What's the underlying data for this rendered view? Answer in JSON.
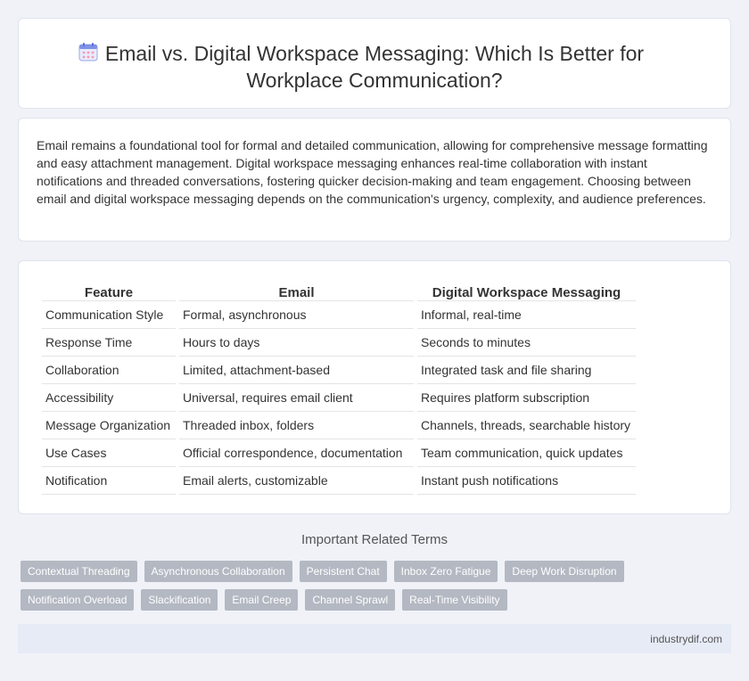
{
  "header": {
    "icon": "calendar-icon",
    "title_line1": "Email vs. Digital Workspace Messaging: Which Is Better for",
    "title_line2": "Workplace Communication?"
  },
  "intro": {
    "text": "Email remains a foundational tool for formal and detailed communication, allowing for comprehensive message formatting and easy attachment management. Digital workspace messaging enhances real-time collaboration with instant notifications and threaded conversations, fostering quicker decision-making and team engagement. Choosing between email and digital workspace messaging depends on the communication's urgency, complexity, and audience preferences."
  },
  "table": {
    "headers": [
      "Feature",
      "Email",
      "Digital Workspace Messaging"
    ],
    "rows": [
      [
        "Communication Style",
        "Formal, asynchronous",
        "Informal, real-time"
      ],
      [
        "Response Time",
        "Hours to days",
        "Seconds to minutes"
      ],
      [
        "Collaboration",
        "Limited, attachment-based",
        "Integrated task and file sharing"
      ],
      [
        "Accessibility",
        "Universal, requires email client",
        "Requires platform subscription"
      ],
      [
        "Message Organization",
        "Threaded inbox, folders",
        "Channels, threads, searchable history"
      ],
      [
        "Use Cases",
        "Official correspondence, documentation",
        "Team communication, quick updates"
      ],
      [
        "Notification",
        "Email alerts, customizable",
        "Instant push notifications"
      ]
    ]
  },
  "terms": {
    "heading": "Important Related Terms",
    "tags": [
      "Contextual Threading",
      "Asynchronous Collaboration",
      "Persistent Chat",
      "Inbox Zero Fatigue",
      "Deep Work Disruption",
      "Notification Overload",
      "Slackification",
      "Email Creep",
      "Channel Sprawl",
      "Real-Time Visibility"
    ]
  },
  "footer": {
    "site": "industrydif.com"
  }
}
